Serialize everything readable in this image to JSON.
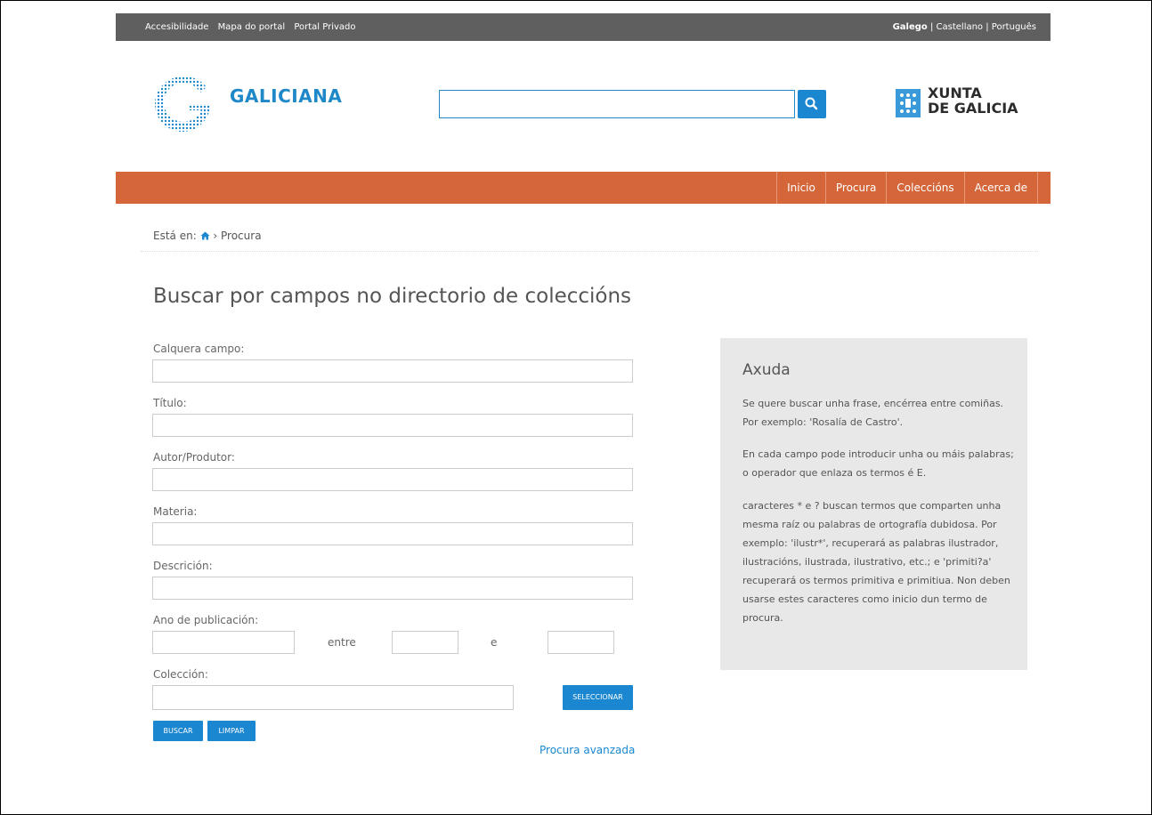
{
  "topbar": {
    "links": [
      "Accesibilidade",
      "Mapa do portal",
      "Portal Privado"
    ],
    "lang_active": "Galego",
    "lang_others": "| Castellano | Português"
  },
  "header": {
    "logo_text": "GALICIANA",
    "search_value": "",
    "xunta_line1": "XUNTA",
    "xunta_line2": "DE GALICIA"
  },
  "nav": {
    "items": [
      "Inicio",
      "Procura",
      "Coleccións",
      "Acerca de"
    ]
  },
  "breadcrumb": {
    "prefix": "Está en:",
    "current": "› Procura"
  },
  "form": {
    "title": "Buscar por campos no directorio de coleccións",
    "any_field_label": "Calquera campo:",
    "title_label": "Título:",
    "author_label": "Autor/Produtor:",
    "subject_label": "Materia:",
    "description_label": "Descrición:",
    "year_label": "Ano de publicación:",
    "between_label": "entre",
    "and_label": "e",
    "collection_label": "Colección:",
    "select_button": "SELECCIONAR",
    "search_button": "BUSCAR",
    "clear_button": "LIMPAR",
    "advanced_link": "Procura avanzada"
  },
  "help": {
    "title": "Axuda",
    "p1": "Se quere buscar unha frase, encérrea entre comiñas. Por exemplo: 'Rosalía de Castro'.",
    "p2": "En cada campo pode introducir unha ou máis palabras; o operador que enlaza os termos é E.",
    "p3": "caracteres * e ? buscan termos que comparten unha mesma raíz ou palabras de ortografía dubidosa. Por exemplo: 'ilustr*', recuperará as palabras ilustrador, ilustracións, ilustrada, ilustrativo, etc.; e 'primiti?a' recuperará os termos primitiva e primitiua. Non deben usarse estes caracteres como inicio dun termo de procura."
  },
  "colors": {
    "nav_bg": "#d4663a",
    "brand_blue": "#1a87d0",
    "topbar_bg": "#5f5f5f"
  },
  "icons": {
    "search": "search-icon",
    "home": "home-icon"
  }
}
